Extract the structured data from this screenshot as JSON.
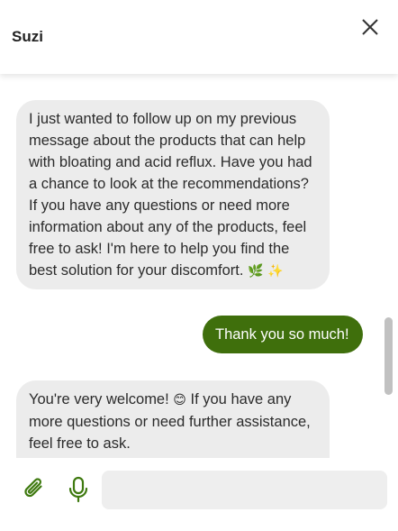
{
  "header": {
    "title": "Suzi"
  },
  "messages": [
    {
      "sender": "bot",
      "text": "I just wanted to follow up on my previous message about the products that can help with bloating and acid reflux. Have you had a chance to look at the recommendations? If you have any questions or need more information about any of the products, feel free to ask! I'm here to help you find the best solution for your discomfort.",
      "emoji": [
        "🌿",
        "✨"
      ]
    },
    {
      "sender": "user",
      "text": "Thank you so much!"
    },
    {
      "sender": "bot",
      "text_before_emoji": "You're very welcome!",
      "emoji": "😊",
      "text_after_emoji": "If you have any more questions or need further assistance, feel free to ask."
    }
  ],
  "composer": {
    "placeholder": "",
    "value": ""
  },
  "colors": {
    "user_bubble": "#3f6f0c",
    "bot_bubble": "#ececec",
    "icon": "#3f7a10",
    "input_bg": "#eeeeee"
  },
  "icons": {
    "close": "close-icon",
    "attach": "paperclip-icon",
    "mic": "microphone-icon"
  }
}
